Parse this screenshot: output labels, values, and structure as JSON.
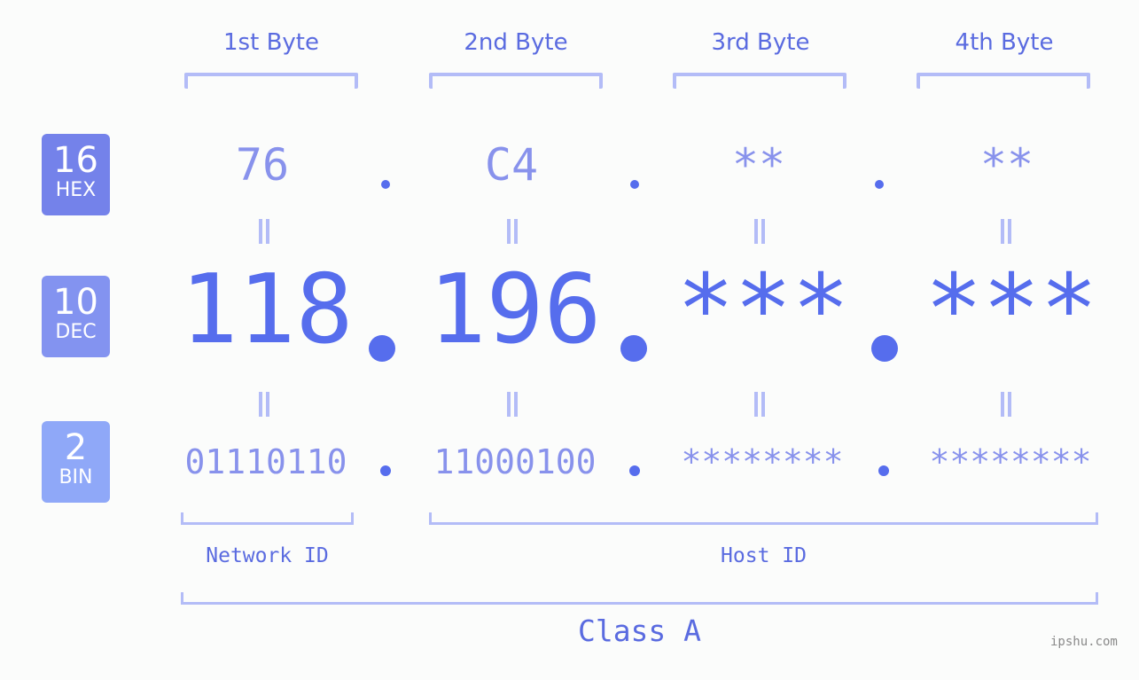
{
  "headers": [
    "1st Byte",
    "2nd Byte",
    "3rd Byte",
    "4th Byte"
  ],
  "badges": {
    "hex": {
      "base": "16",
      "label": "HEX",
      "color": "#7482ea"
    },
    "dec": {
      "base": "10",
      "label": "DEC",
      "color": "#8393f0"
    },
    "bin": {
      "base": "2",
      "label": "BIN",
      "color": "#8fa8f8"
    }
  },
  "hex": [
    "76",
    "C4",
    "**",
    "**"
  ],
  "dec": [
    "118",
    "196",
    "***",
    "***"
  ],
  "bin": [
    "01110110",
    "11000100",
    "********",
    "********"
  ],
  "separator": ".",
  "equals_symbol": "=",
  "network_id_label": "Network ID",
  "host_id_label": "Host ID",
  "class_label": "Class A",
  "watermark": "ipshu.com",
  "colors": {
    "background": "#fbfcfb",
    "accent": "#566ded",
    "light_value": "#8892ec",
    "bracket": "#b3bcf7",
    "label": "#5a6be0"
  }
}
